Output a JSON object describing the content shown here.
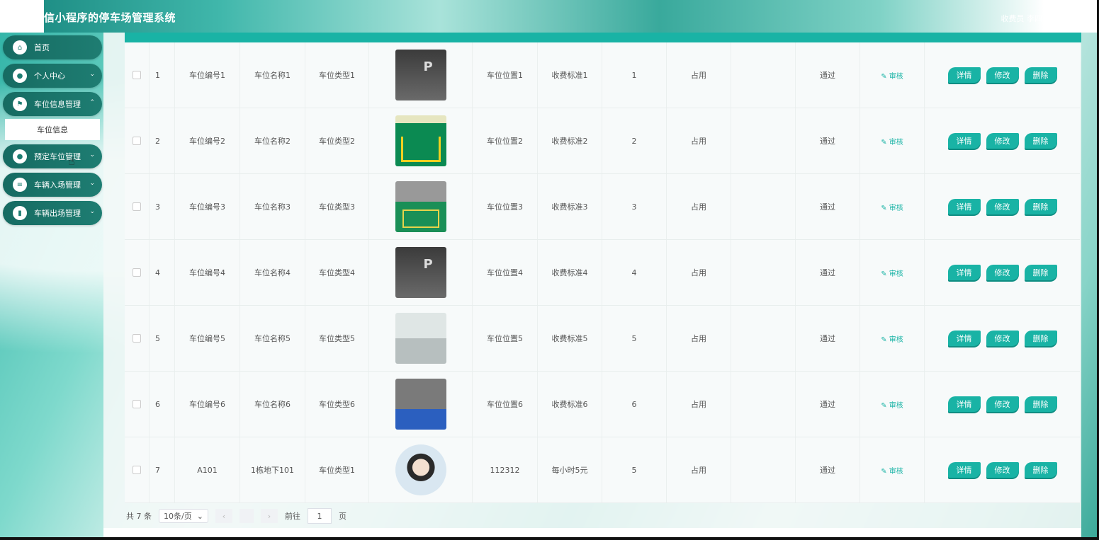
{
  "header": {
    "title": "微信小程序的停车场管理系统",
    "title_visible": "信小程序的停车场管理系统",
    "user": "收费员 李四"
  },
  "sidebar": {
    "items": [
      {
        "label": "首页",
        "icon": "home-icon"
      },
      {
        "label": "个人中心",
        "icon": "user-icon"
      },
      {
        "label": "车位信息管理",
        "icon": "flag-icon"
      },
      {
        "label": "预定车位管理",
        "icon": "user-icon"
      },
      {
        "label": "车辆入场管理",
        "icon": "list-icon"
      },
      {
        "label": "车辆出场管理",
        "icon": "bar-chart-icon"
      }
    ],
    "submenu": "车位信息"
  },
  "table": {
    "rows": [
      {
        "no": "1",
        "code": "车位编号1",
        "name": "车位名称1",
        "type": "车位类型1",
        "img": "dark",
        "loc": "车位位置1",
        "fee": "收费标准1",
        "floor": "1",
        "status": "占用",
        "review": "通过",
        "audit": "审核"
      },
      {
        "no": "2",
        "code": "车位编号2",
        "name": "车位名称2",
        "type": "车位类型2",
        "img": "green",
        "loc": "车位位置2",
        "fee": "收费标准2",
        "floor": "2",
        "status": "占用",
        "review": "通过",
        "audit": "审核"
      },
      {
        "no": "3",
        "code": "车位编号3",
        "name": "车位名称3",
        "type": "车位类型3",
        "img": "green2",
        "loc": "车位位置3",
        "fee": "收费标准3",
        "floor": "3",
        "status": "占用",
        "review": "通过",
        "audit": "审核"
      },
      {
        "no": "4",
        "code": "车位编号4",
        "name": "车位名称4",
        "type": "车位类型4",
        "img": "dark",
        "loc": "车位位置4",
        "fee": "收费标准4",
        "floor": "4",
        "status": "占用",
        "review": "通过",
        "audit": "审核"
      },
      {
        "no": "5",
        "code": "车位编号5",
        "name": "车位名称5",
        "type": "车位类型5",
        "img": "hall",
        "loc": "车位位置5",
        "fee": "收费标准5",
        "floor": "5",
        "status": "占用",
        "review": "通过",
        "audit": "审核"
      },
      {
        "no": "6",
        "code": "车位编号6",
        "name": "车位名称6",
        "type": "车位类型6",
        "img": "blue",
        "loc": "车位位置6",
        "fee": "收费标准6",
        "floor": "6",
        "status": "占用",
        "review": "通过",
        "audit": "审核"
      },
      {
        "no": "7",
        "code": "A101",
        "name": "1栋地下101",
        "type": "车位类型1",
        "img": "girl",
        "loc": "112312",
        "fee": "每小时5元",
        "floor": "5",
        "status": "占用",
        "review": "通过",
        "audit": "审核"
      }
    ],
    "actions": {
      "detail": "详情",
      "edit": "修改",
      "delete": "删除"
    }
  },
  "pager": {
    "total": "共 7 条",
    "page_size": "10条/页",
    "goto": "前往",
    "page": "1",
    "page_suffix": "页"
  },
  "colors": {
    "accent": "#19b3a5",
    "sidebar": "#1e7d72"
  }
}
